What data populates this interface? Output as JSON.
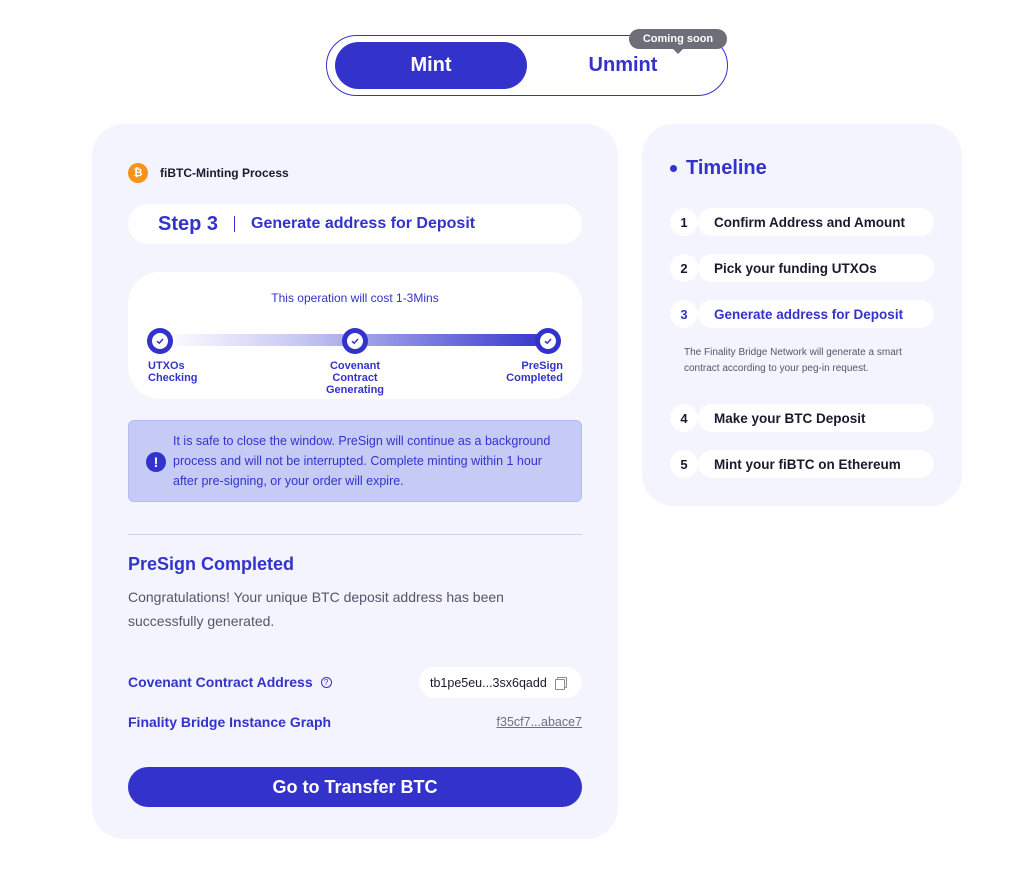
{
  "toggle": {
    "mint_label": "Mint",
    "unmint_label": "Unmint",
    "badge": "Coming soon"
  },
  "process": {
    "icon": "bitcoin-icon",
    "title": "fiBTC-Minting Process",
    "step_number": "Step 3",
    "step_label": "Generate address for Deposit"
  },
  "progress": {
    "cost_text": "This operation will cost 1-3Mins",
    "stages": [
      {
        "label_line1": "UTXOs",
        "label_line2": "Checking",
        "label_line3": "",
        "done": true
      },
      {
        "label_line1": "Covenant",
        "label_line2": "Contract",
        "label_line3": "Generating",
        "done": true
      },
      {
        "label_line1": "PreSign",
        "label_line2": "Completed",
        "label_line3": "",
        "done": true
      }
    ]
  },
  "notice": {
    "icon": "exclamation-icon",
    "text": "It is safe to close the window. PreSign will continue as a background process and will not be interrupted. Complete minting within 1 hour after pre-signing, or your order will expire."
  },
  "result": {
    "title": "PreSign Completed",
    "description": "Congratulations! Your unique BTC deposit address has been successfully generated.",
    "contract_label": "Covenant Contract Address",
    "contract_help_icon": "question-circle-icon",
    "contract_value": "tb1pe5eu...3sx6qadd",
    "copy_icon": "copy-icon",
    "graph_label": "Finality Bridge Instance Graph",
    "graph_value": "f35cf7...abace7",
    "cta_label": "Go to Transfer BTC"
  },
  "timeline": {
    "title": "Timeline",
    "items": [
      {
        "num": "1",
        "label": "Confirm Address and Amount"
      },
      {
        "num": "2",
        "label": "Pick your funding UTXOs"
      },
      {
        "num": "3",
        "label": "Generate address for Deposit"
      },
      {
        "num": "4",
        "label": "Make your BTC Deposit"
      },
      {
        "num": "5",
        "label": "Mint your fiBTC on Ethereum"
      }
    ],
    "active_index": 2,
    "active_description": "The Finality Bridge Network will generate a smart contract according to your peg-in request."
  },
  "colors": {
    "primary": "#3333cc",
    "card_bg": "#f3f4fd",
    "notice_bg": "#c5cbf5",
    "badge_bg": "#6e6e78",
    "bitcoin": "#f7931a"
  }
}
